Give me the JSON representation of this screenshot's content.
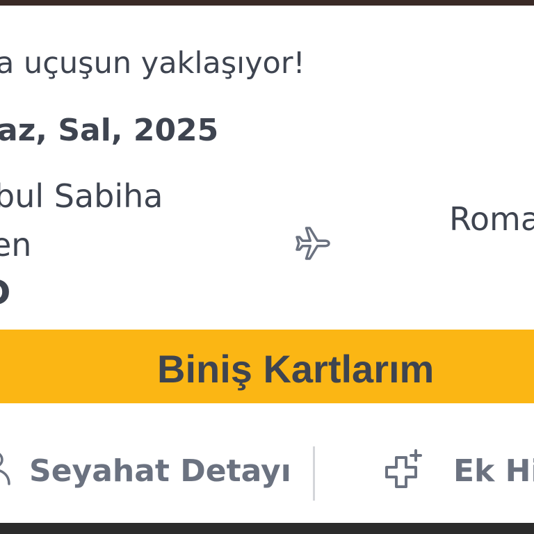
{
  "header_strip_color": "#3a2a26",
  "flight_card": {
    "headline": "a uçuşun yaklaşıyor!",
    "date": "az, Sal, 2025",
    "origin_line1": "bul Sabiha",
    "origin_line2": "en",
    "origin_code": "D",
    "plane_icon": "plane-icon",
    "destination": "Roma"
  },
  "boarding_button": {
    "label": "Biniş Kartlarım",
    "color": "#fbb614"
  },
  "bottom_nav": {
    "travel_detail": {
      "label": "Seyahat Detayı",
      "icon": "person-icon"
    },
    "extra_services": {
      "label": "Ek Hiz",
      "icon": "plus-icon"
    }
  },
  "colors": {
    "text_primary": "#3e4450",
    "text_secondary": "#6b7280",
    "icon": "#6b7280"
  }
}
